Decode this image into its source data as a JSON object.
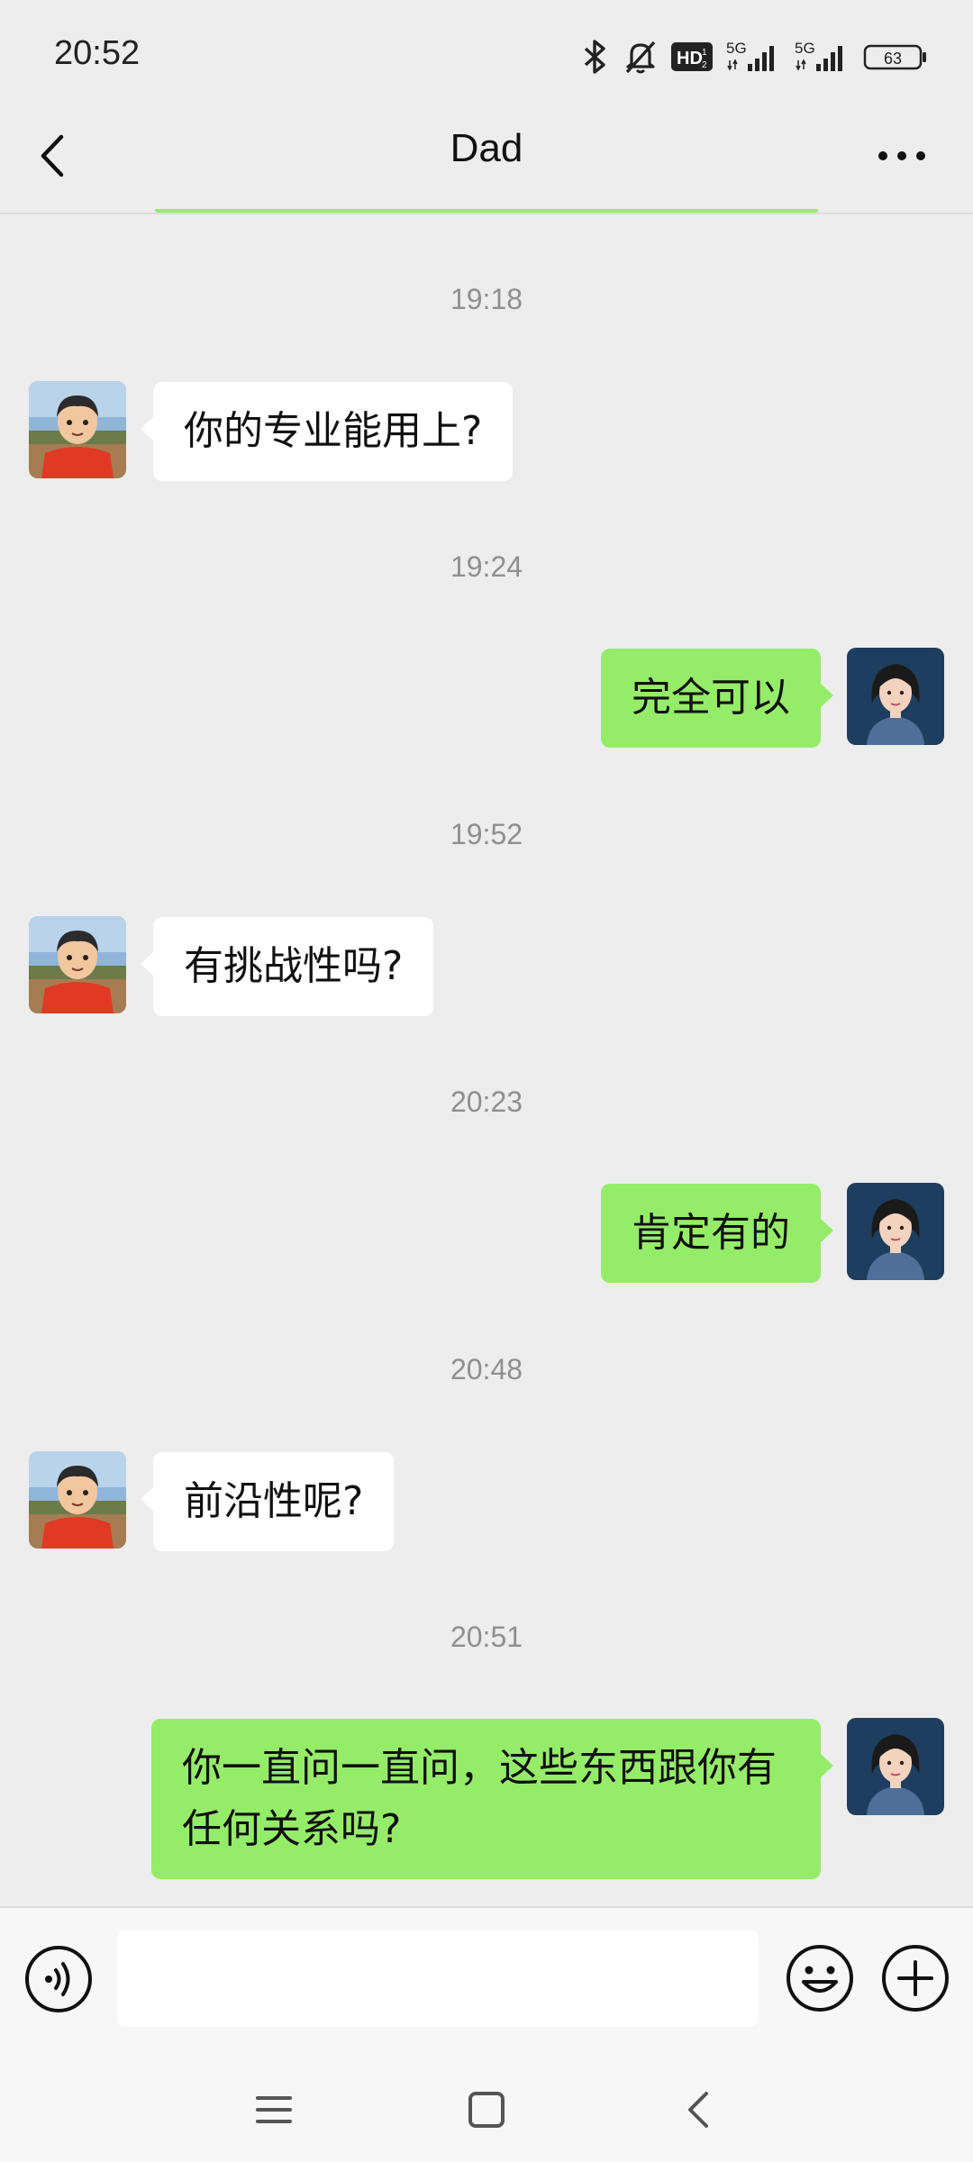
{
  "status_bar": {
    "time": "20:52",
    "battery": "63",
    "network_1": "5G",
    "network_2": "5G",
    "hd_label": "HD",
    "icons": [
      "bluetooth-icon",
      "mute-bell-icon",
      "hd-icon",
      "signal-5g-icon",
      "signal-5g-icon",
      "battery-icon"
    ]
  },
  "header": {
    "title": "Dad",
    "back_icon": "chevron-left-icon",
    "more_icon": "more-dots-icon"
  },
  "messages": [
    {
      "time": "19:18",
      "from": "Dad",
      "direction": "in",
      "text": "你的专业能用上?"
    },
    {
      "time": "19:24",
      "from": "me",
      "direction": "out",
      "text": "完全可以"
    },
    {
      "time": "19:52",
      "from": "Dad",
      "direction": "in",
      "text": "有挑战性吗?"
    },
    {
      "time": "20:23",
      "from": "me",
      "direction": "out",
      "text": "肯定有的"
    },
    {
      "time": "20:48",
      "from": "Dad",
      "direction": "in",
      "text": "前沿性呢?"
    },
    {
      "time": "20:51",
      "from": "me",
      "direction": "out",
      "text_lines": [
        "你一直问一直问，这些东西跟你有",
        "任何关系吗?"
      ]
    }
  ],
  "input_bar": {
    "voice_icon": "voice-input-icon",
    "emoji_icon": "emoji-icon",
    "plus_icon": "plus-icon",
    "value": ""
  },
  "nav_bar": {
    "icons": [
      "menu-icon",
      "home-icon",
      "back-icon"
    ]
  },
  "colors": {
    "background": "#ededed",
    "outgoing_bubble": "#95ec69",
    "incoming_bubble": "#ffffff",
    "timestamp": "#8f8f8f"
  }
}
